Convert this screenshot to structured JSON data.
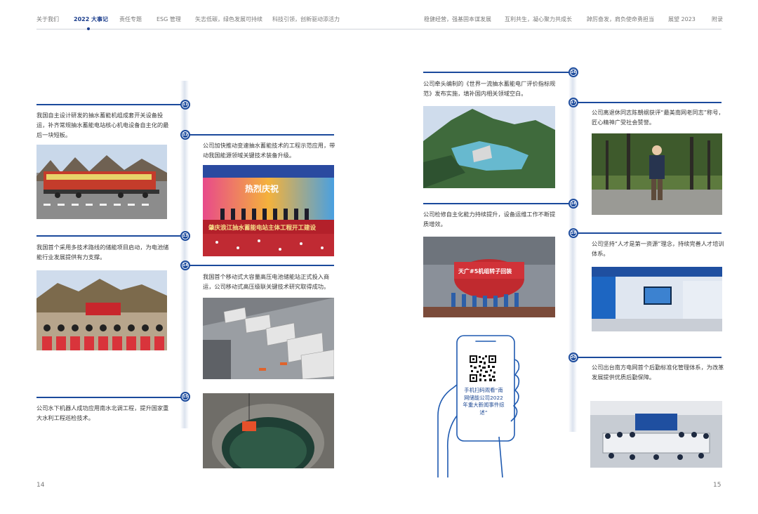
{
  "nav": {
    "items": [
      "关于我们",
      "2022 大事记",
      "责任专题",
      "ESG 管理",
      "矢志低碳，绿色发展可持续",
      "科技引领，创新驱动添活力",
      "稳健经营，强基固本谋发展",
      "互利共生，凝心聚力共成长",
      "踔厉奋发，肩负使命勇担当",
      "展望 2023",
      "附录"
    ],
    "active_index": 1
  },
  "events": [
    {
      "num": "11",
      "text": "我国自主设计研发的抽水蓄能机组成套开关设备投运，补齐常规抽水蓄能电站核心机电设备自主化的最后一块短板。"
    },
    {
      "num": "12",
      "text": "公司加快推动变速抽水蓄能技术的工程示范应用，带动我国能源领域关键技术装备升级。"
    },
    {
      "num": "13",
      "text": "我国首个采用多技术路线的储能项目启动，为电池储能行业发展提供有力支撑。"
    },
    {
      "num": "14",
      "text": "我国首个移动式大容量高压电池储能站正式投入商运，公司移动式高压级联关键技术研究取得成功。"
    },
    {
      "num": "15",
      "text": "公司水下机器人成功应用南水北调工程，提升国家重大水利工程巡检技术。"
    },
    {
      "num": "16",
      "text": "公司牵头编制的《世界一流抽水蓄能电厂评价指标规范》发布实施，填补国内相关领域空白。"
    },
    {
      "num": "17",
      "text": "公司离退休同志陈朝纲获评“最美南网老同志”称号，匠心精神广受社会赞誉。"
    },
    {
      "num": "18",
      "text": "公司检修自主化能力持续提升，设备运维工作不断提质增效。"
    },
    {
      "num": "19",
      "text": "公司坚持“人才是第一资源”理念，持续完善人才培训体系。"
    },
    {
      "num": "20",
      "text": "公司出台南方电网首个后勤标准化管理体系，为改革发展提供优质后勤保障。"
    }
  ],
  "photo_text": {
    "banner12_top": "热烈庆祝",
    "banner12_main": "肇庆浪江抽水蓄能电站主体工程开工建设",
    "banner18": "天广#5机组转子回装"
  },
  "qr": {
    "caption": "手机扫码观看“南网储能公司2022年重大新闻事件综述”"
  },
  "pages": {
    "left": "14",
    "right": "15"
  },
  "colors": {
    "accent": "#1b4a9c",
    "nav_active": "#1b3d8c"
  }
}
